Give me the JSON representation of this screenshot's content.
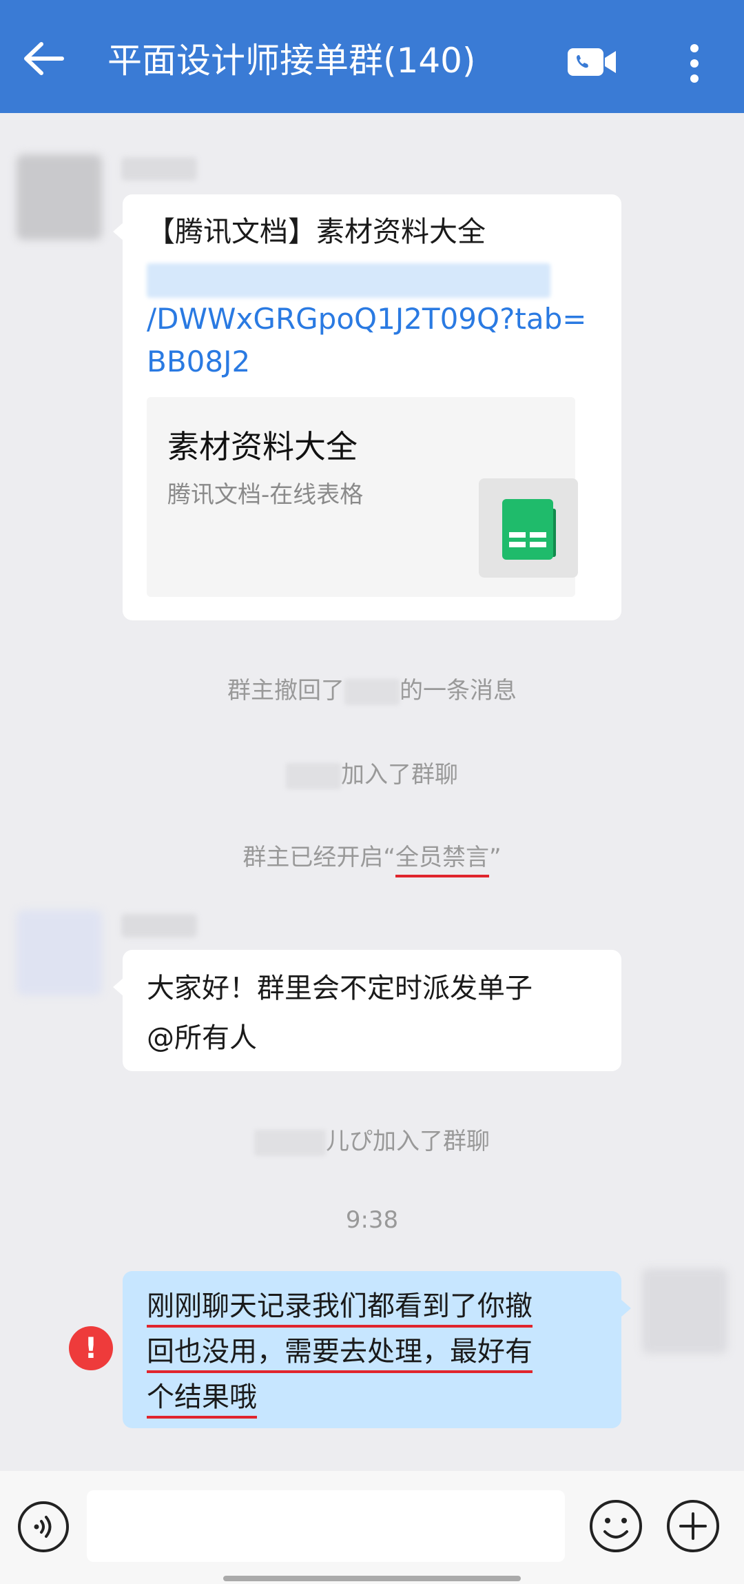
{
  "header": {
    "title": "平面设计师接单群(140)",
    "back_icon": "arrow-left-icon",
    "video_icon": "video-call-icon",
    "more_icon": "more-vertical-icon"
  },
  "messages": {
    "doc_share": {
      "text": "【腾讯文档】素材资料大全",
      "link": "/DWWxGRGpoQ1J2T09Q?tab=BB08J2",
      "card_title": "素材资料大全",
      "card_subtitle": "腾讯文档-在线表格",
      "card_icon": "spreadsheet-icon"
    },
    "sys_recall": {
      "prefix": "群主撤回了",
      "suffix": "的一条消息"
    },
    "sys_join1": {
      "suffix": "加入了群聊"
    },
    "sys_mute": {
      "prefix": "群主已经开启“",
      "highlight": "全员禁言",
      "suffix": "”"
    },
    "announce": {
      "line1": "大家好！群里会不定时派发单子",
      "line2": "@所有人"
    },
    "sys_join2": {
      "suffix": "儿ぴ加入了群聊"
    },
    "time": "9:38",
    "mine": {
      "line1": "刚刚聊天记录我们都看到了你撤",
      "line2": "回也没用，需要去处理，最好有",
      "line3": "个结果哦",
      "error_mark": "!"
    }
  },
  "inputbar": {
    "voice_icon": "voice-icon",
    "emoji_icon": "emoji-icon",
    "plus_icon": "plus-icon"
  },
  "colors": {
    "header_bg": "#3a7bd5",
    "link": "#2a7ae2",
    "mine_bubble": "#c7e6ff",
    "error": "#ee3b3b",
    "sheet_green": "#1fbb6b"
  }
}
